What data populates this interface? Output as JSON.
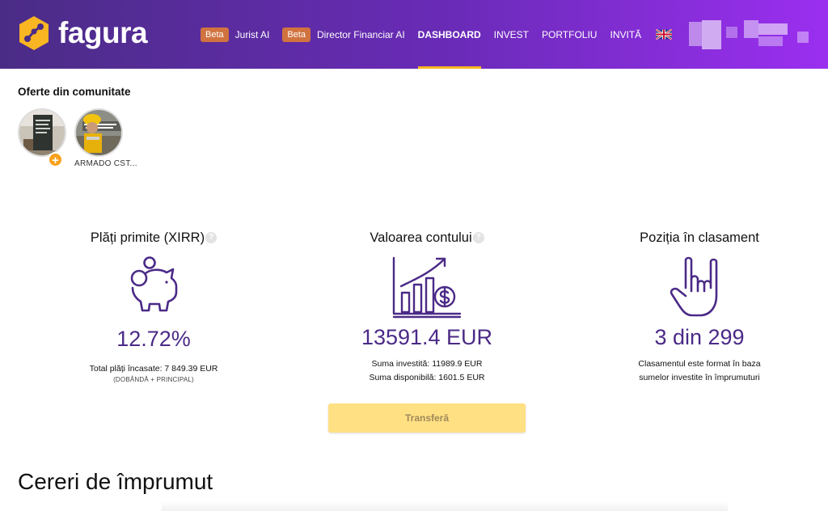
{
  "brand": {
    "name": "fagura",
    "icon": "hexagon-network-icon",
    "color": "#f9b522"
  },
  "nav": {
    "items": [
      {
        "badge": "Beta",
        "label": "Jurist AI"
      },
      {
        "badge": "Beta",
        "label": "Director Financiar AI"
      },
      {
        "label": "DASHBOARD",
        "active": true
      },
      {
        "label": "INVEST"
      },
      {
        "label": "PORTFOLIU"
      },
      {
        "label": "INVITĂ"
      }
    ],
    "language_icon": "uk-flag-icon"
  },
  "community": {
    "title": "Oferte din comunitate",
    "stories": [
      {
        "icon": "story-thumbnail",
        "add_icon": "+"
      },
      {
        "label": "ARMADO CST..."
      }
    ]
  },
  "stats": {
    "payments": {
      "title": "Plăți primite (XIRR)",
      "help": "?",
      "value": "12.72%",
      "note": "Total plăți încasate: 7 849.39 EUR",
      "sub": "(DOBÂNDĂ + PRINCIPAL)",
      "icon": "piggy-bank-icon"
    },
    "account": {
      "title": "Valoarea contului",
      "help": "?",
      "value": "13591.4 EUR",
      "invested": "Suma investită: 11989.9 EUR",
      "available": "Suma disponibilă: 1601.5 EUR",
      "icon": "growth-chart-icon",
      "button": "Transferă"
    },
    "ranking": {
      "title": "Poziția în clasament",
      "value": "3 din 299",
      "note1": "Clasamentul este format în baza",
      "note2": "sumelor investite în împrumuturi",
      "icon": "rock-hand-icon"
    }
  },
  "loans": {
    "title": "Cereri de împrumut"
  },
  "colors": {
    "accent": "#4b2a87",
    "header_start": "#4a2c86",
    "header_end": "#9b2ff0",
    "badge": "#d1733f",
    "button": "#ffe083"
  }
}
